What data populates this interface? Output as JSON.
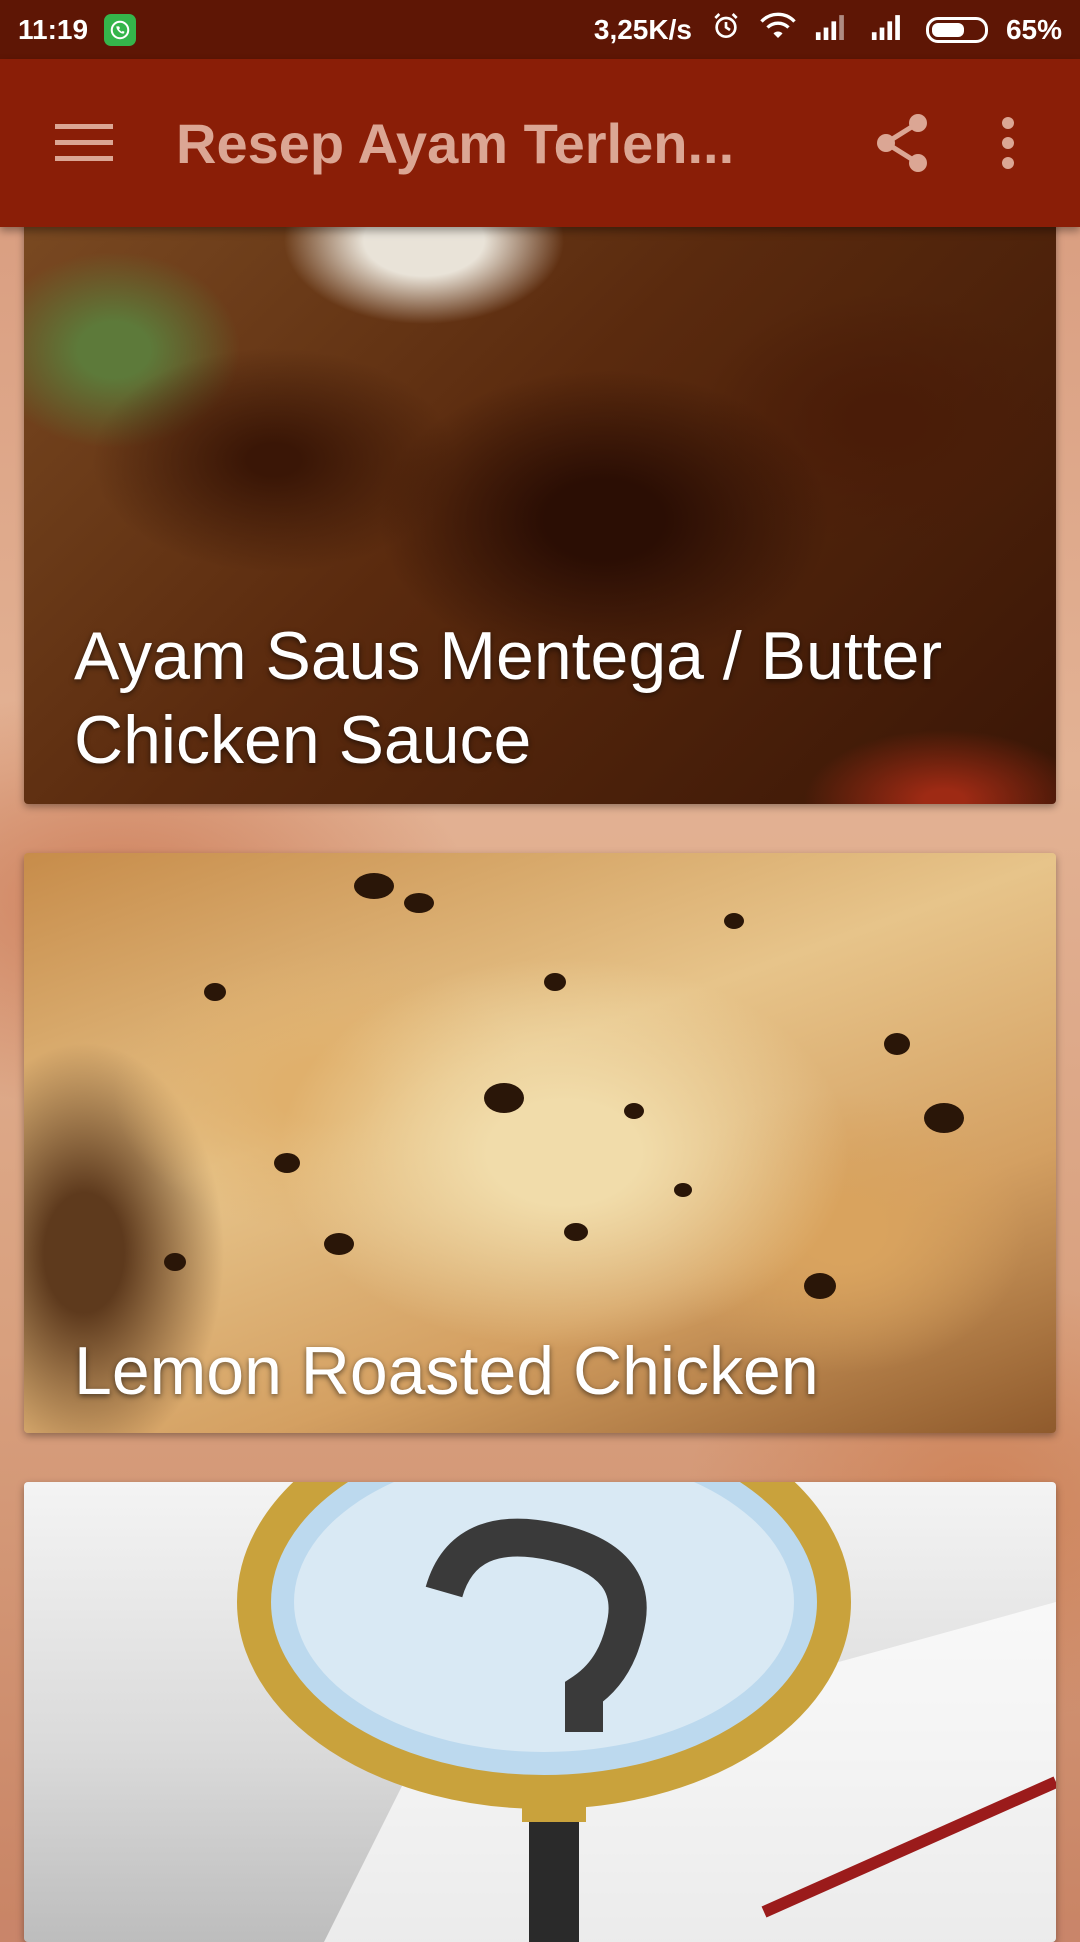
{
  "status_bar": {
    "time": "11:19",
    "network_speed": "3,25K/s",
    "battery_percent": "65%",
    "battery_level": 0.65,
    "icons": [
      "whatsapp-icon",
      "alarm-icon",
      "wifi-icon",
      "signal-icon",
      "signal-icon",
      "battery-icon"
    ]
  },
  "toolbar": {
    "title": "Resep Ayam Terlen...",
    "menu_icon": "hamburger-menu-icon",
    "share_icon": "share-icon",
    "more_icon": "more-vert-icon",
    "color": "#8a1e07"
  },
  "cards": [
    {
      "title": "Ayam Saus Mentega / Butter Chicken Sauce"
    },
    {
      "title": "Lemon Roasted Chicken"
    },
    {
      "title": ""
    }
  ],
  "colors": {
    "status_bar": "#5e1605",
    "toolbar": "#8a1e07",
    "title_text": "#dba694"
  }
}
